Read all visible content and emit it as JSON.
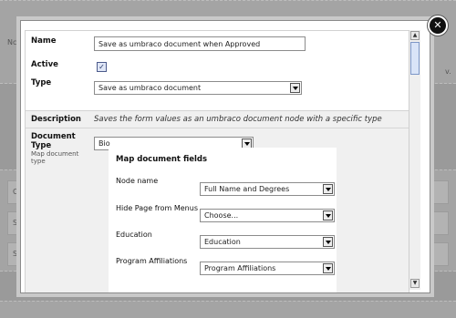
{
  "top": {
    "name_label": "Name",
    "name_value": "Save as umbraco document when Approved",
    "active_label": "Active",
    "active_checked": true,
    "type_label": "Type",
    "type_value": "Save as umbraco document"
  },
  "settings": {
    "description_label": "Description",
    "description_text": "Saves the form values as an umbraco document node with a specific type",
    "document_type_label_line1": "Document",
    "document_type_label_line2": "Type",
    "document_type_hint_line1": "Map document",
    "document_type_hint_line2": "type",
    "document_type_value": "Bio"
  },
  "mapping": {
    "title": "Map document fields",
    "rows": [
      {
        "label": "Node name",
        "value": "Full Name and Degrees"
      },
      {
        "label": "Hide Page from Menus",
        "value": "Choose..."
      },
      {
        "label": "Education",
        "value": "Education"
      },
      {
        "label": "Program Affiliations",
        "value": "Program Affiliations"
      }
    ]
  },
  "background": {
    "letters": [
      "Nc",
      "v.",
      "C",
      "S",
      "S"
    ]
  },
  "icons": {
    "close": "close-icon",
    "check": "checkmark-icon",
    "dropdown": "dropdown-arrow-icon",
    "scroll_up": "scroll-up-icon",
    "scroll_down": "scroll-down-icon"
  }
}
